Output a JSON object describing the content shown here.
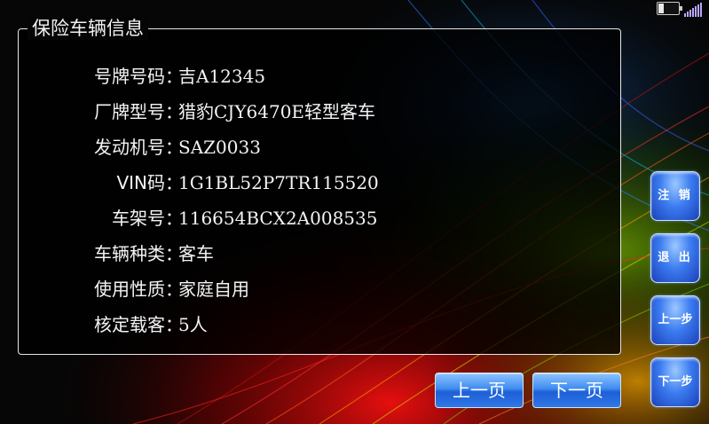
{
  "panel": {
    "title": "保险车辆信息",
    "fields": [
      {
        "label": "号牌号码：",
        "value": "吉A12345"
      },
      {
        "label": "厂牌型号：",
        "value": "猎豹CJY6470E轻型客车"
      },
      {
        "label": "发动机号：",
        "value": "SAZ0033"
      },
      {
        "label": "VIN码：",
        "value": "1G1BL52P7TR115520"
      },
      {
        "label": "车架号：",
        "value": "116654BCX2A008535"
      },
      {
        "label": "车辆种类：",
        "value": "客车"
      },
      {
        "label": "使用性质：",
        "value": "家庭自用"
      },
      {
        "label": "核定载客：",
        "value": "5人"
      }
    ]
  },
  "pager": {
    "prev_label": "上一页",
    "next_label": "下一页"
  },
  "side": {
    "logout_label": "注 销",
    "exit_label": "退 出",
    "prev_step_label": "上一步",
    "next_step_label": "下一步"
  },
  "status": {
    "battery_icon": "battery-icon",
    "signal_icon": "signal-icon"
  }
}
